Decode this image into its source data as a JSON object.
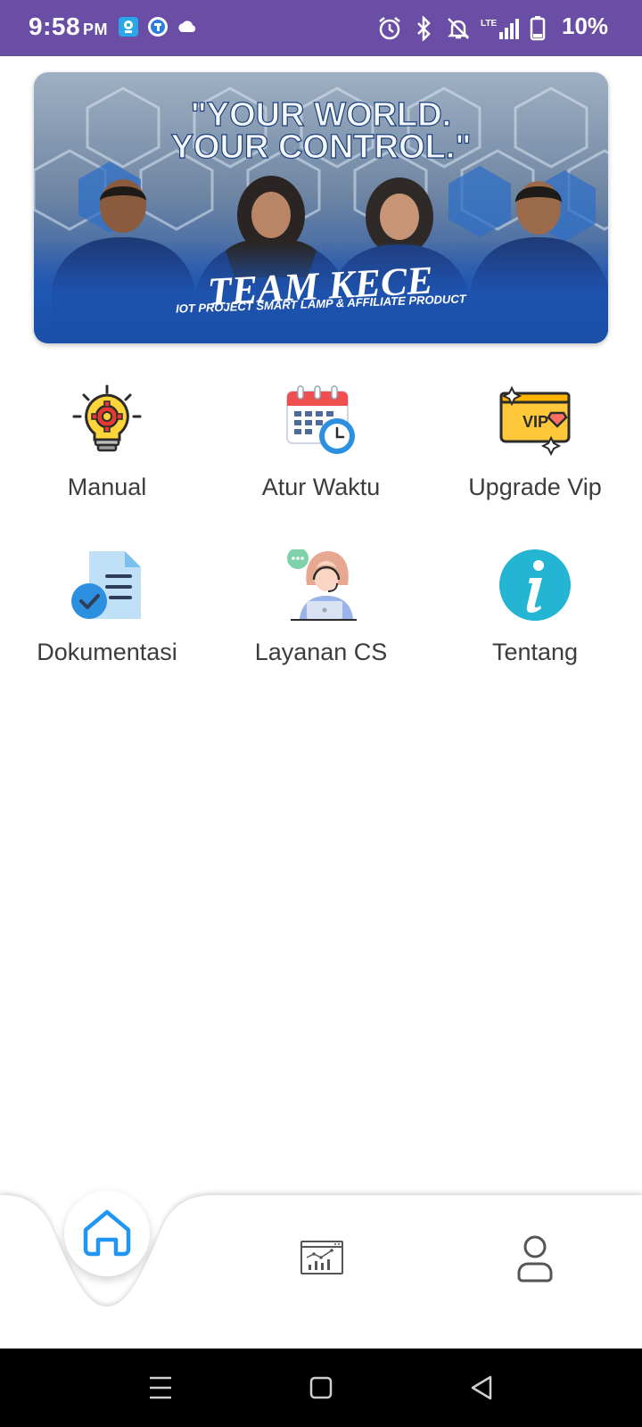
{
  "status_bar": {
    "time": "9:58",
    "ampm": "PM",
    "network": "LTE",
    "battery": "10%",
    "background_color": "#6a4ea5"
  },
  "banner": {
    "headline_line1": "\"YOUR WORLD.",
    "headline_line2": "YOUR CONTROL.\"",
    "team_name": "TEAM KECE",
    "tagline": "IOT PROJECT SMART LAMP & AFFILIATE PRODUCT"
  },
  "menu": {
    "items": [
      {
        "label": "Manual",
        "icon": "lightbulb-gear-icon"
      },
      {
        "label": "Atur Waktu",
        "icon": "calendar-clock-icon"
      },
      {
        "label": "Upgrade Vip",
        "icon": "vip-ticket-icon"
      },
      {
        "label": "Dokumentasi",
        "icon": "document-check-icon"
      },
      {
        "label": "Layanan CS",
        "icon": "customer-service-icon"
      },
      {
        "label": "Tentang",
        "icon": "info-icon"
      }
    ]
  },
  "bottom_nav": {
    "items": [
      {
        "name": "home",
        "icon": "home-icon",
        "active": true,
        "color": "#2196f3"
      },
      {
        "name": "statistics",
        "icon": "chart-window-icon",
        "active": false
      },
      {
        "name": "profile",
        "icon": "user-icon",
        "active": false
      }
    ]
  },
  "system_nav": {
    "buttons": [
      "menu-icon",
      "home-square-icon",
      "back-triangle-icon"
    ]
  }
}
